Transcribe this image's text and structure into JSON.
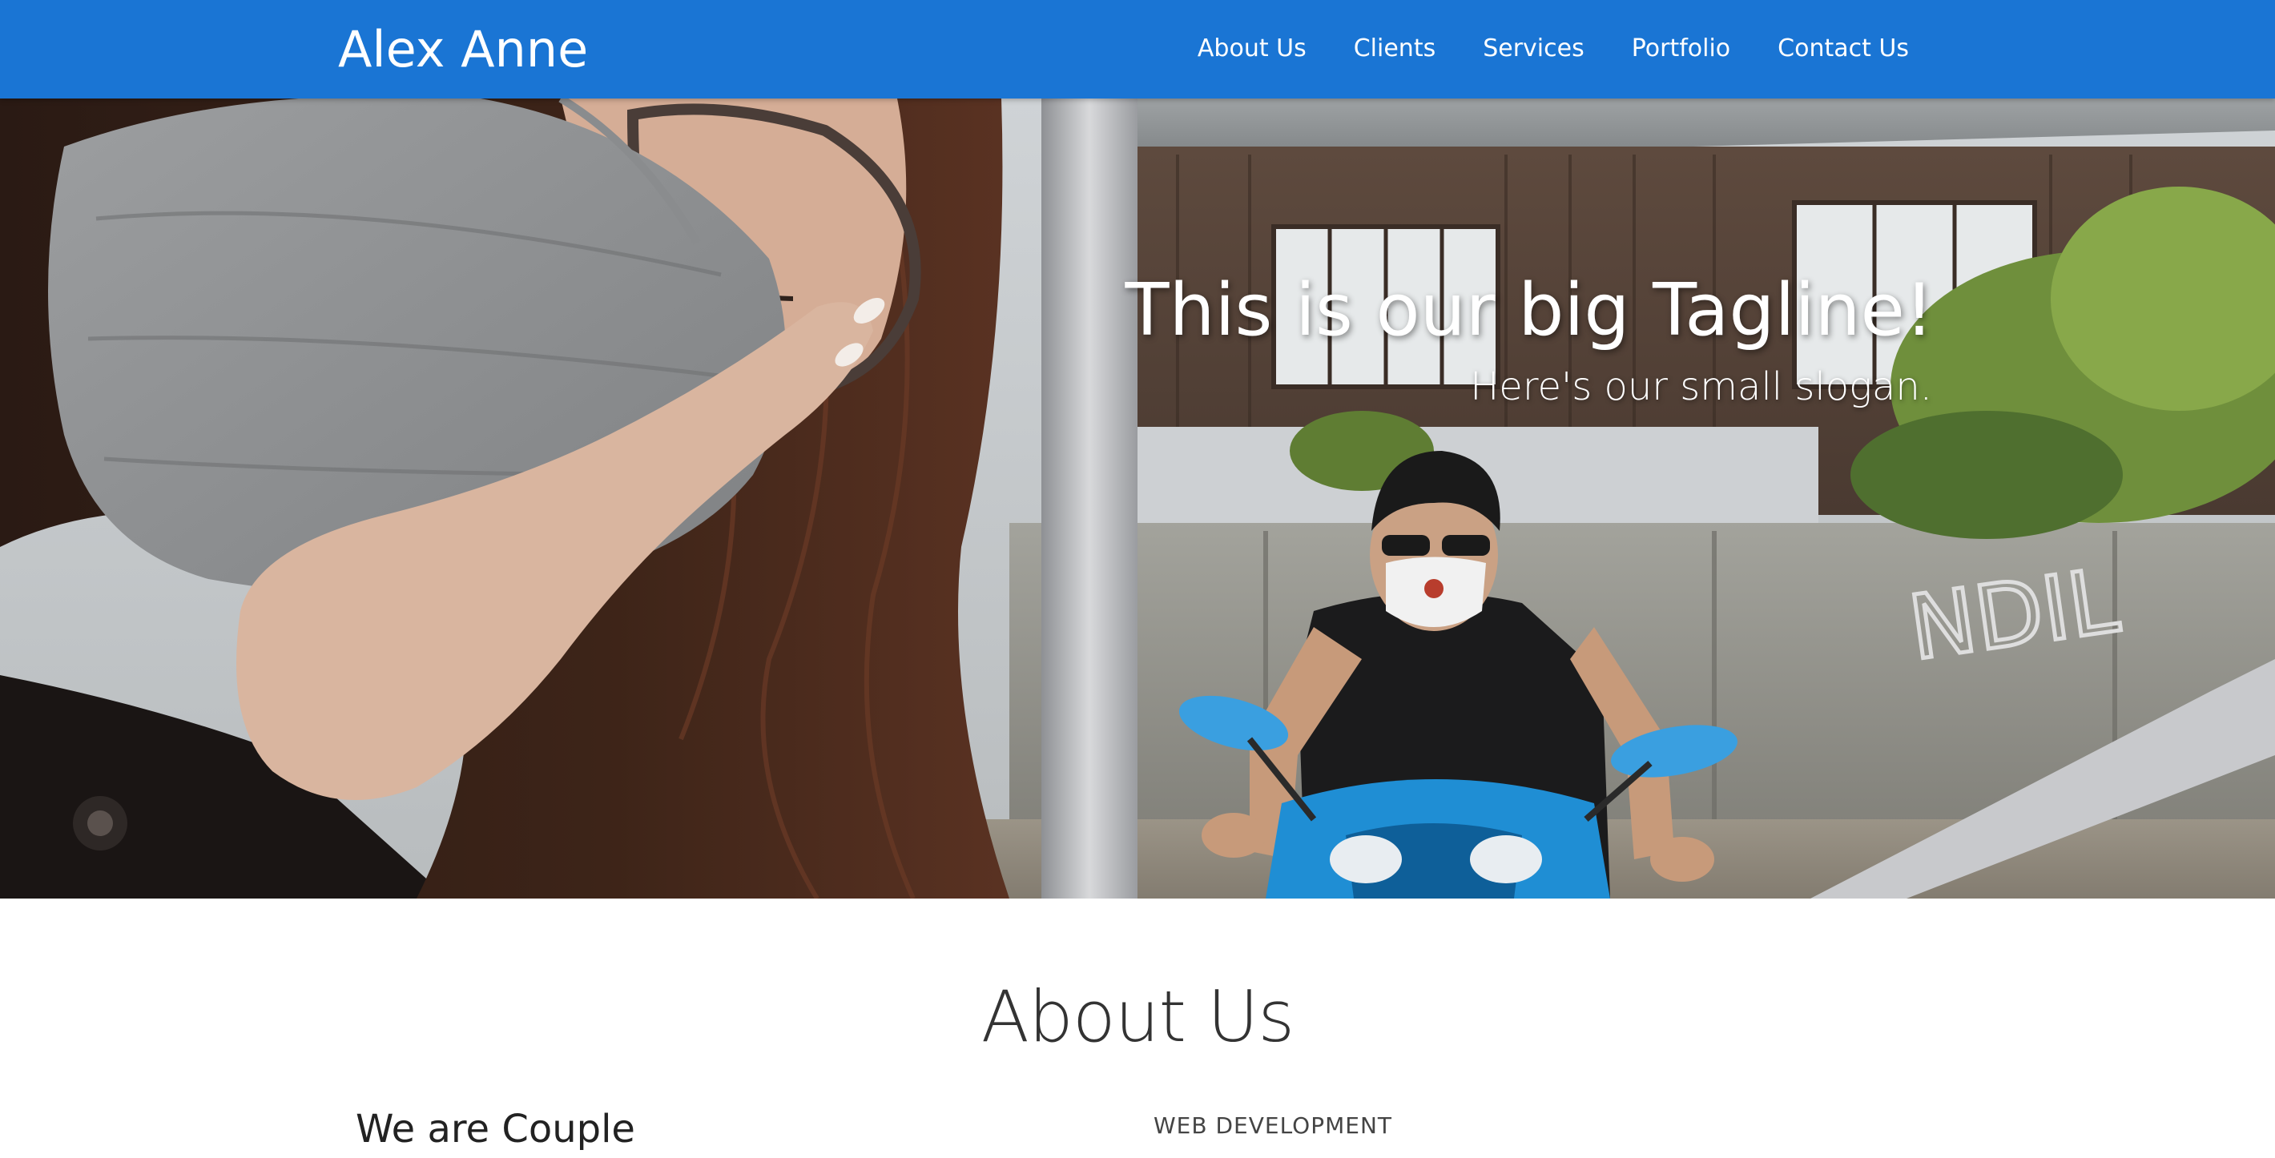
{
  "header": {
    "brand": "Alex Anne",
    "nav": [
      "About Us",
      "Clients",
      "Services",
      "Portfolio",
      "Contact Us"
    ],
    "background_color": "#1a75d4"
  },
  "hero": {
    "tagline": "This is our big Tagline!",
    "slogan": "Here's our small slogan."
  },
  "about": {
    "title": "About Us",
    "subtitle": "We are Couple",
    "skill_label": "WEB DEVELOPMENT"
  }
}
